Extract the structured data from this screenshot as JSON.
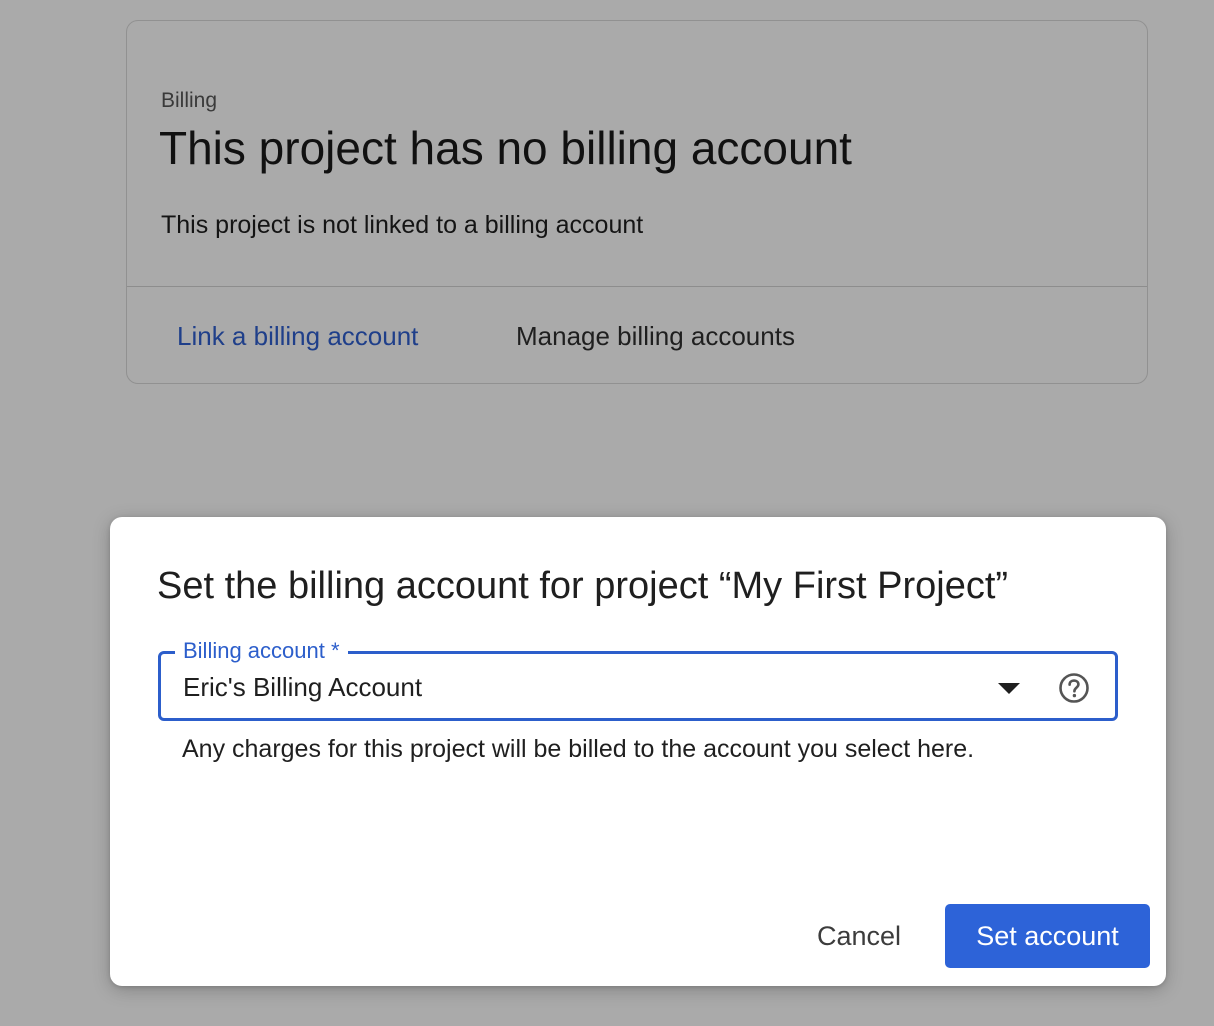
{
  "billing_card": {
    "eyebrow": "Billing",
    "title": "This project has no billing account",
    "description": "This project is not linked to a billing account",
    "actions": {
      "link_label": "Link a billing account",
      "manage_label": "Manage billing accounts"
    }
  },
  "dialog": {
    "title": "Set the billing account for project “My First Project”",
    "billing_select": {
      "label": "Billing account *",
      "value": "Eric's Billing Account",
      "icons": [
        "dropdown-arrow-icon",
        "help-icon"
      ]
    },
    "helper_text": "Any charges for this project will be billed to the account you select here.",
    "buttons": {
      "cancel_label": "Cancel",
      "set_label": "Set account"
    }
  },
  "colors": {
    "overlay_background": "#aaaaaa",
    "accent": "#2c5ecb",
    "primary_button": "#2d63d8",
    "link": "#1f3f8a"
  }
}
